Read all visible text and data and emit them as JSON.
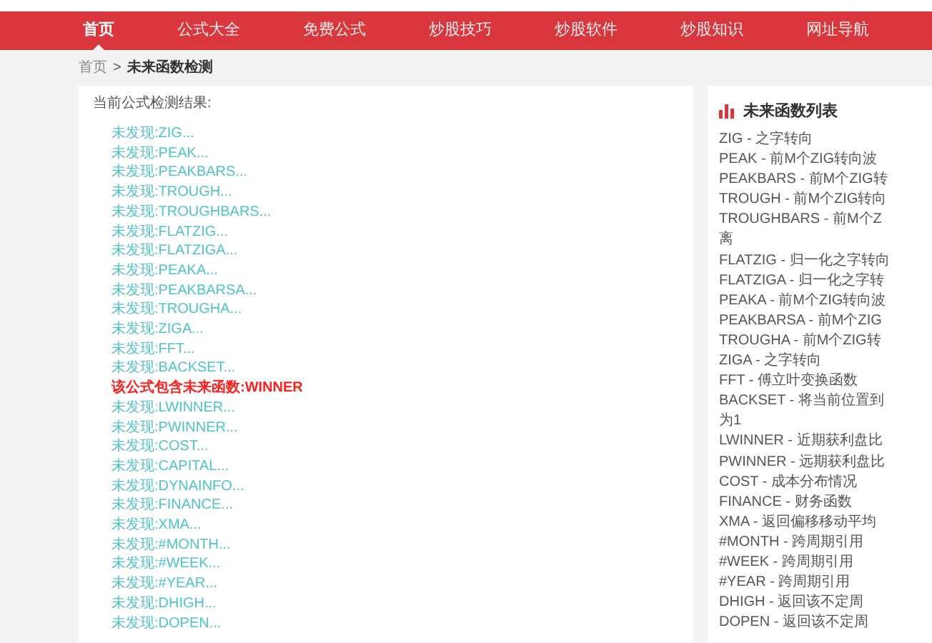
{
  "nav": [
    {
      "label": "首页",
      "selected": true
    },
    {
      "label": "公式大全",
      "selected": false
    },
    {
      "label": "免费公式",
      "selected": false
    },
    {
      "label": "炒股技巧",
      "selected": false
    },
    {
      "label": "炒股软件",
      "selected": false
    },
    {
      "label": "炒股知识",
      "selected": false
    },
    {
      "label": "网址导航",
      "selected": false
    }
  ],
  "breadcrumb": {
    "home": "首页",
    "separator": ">",
    "current": "未来函数检测"
  },
  "results": {
    "title": "当前公式检测结果:",
    "items": [
      {
        "kind": "ok",
        "text": "未发现:ZIG..."
      },
      {
        "kind": "ok",
        "text": "未发现:PEAK..."
      },
      {
        "kind": "ok",
        "text": "未发现:PEAKBARS..."
      },
      {
        "kind": "ok",
        "text": "未发现:TROUGH..."
      },
      {
        "kind": "ok",
        "text": "未发现:TROUGHBARS..."
      },
      {
        "kind": "ok",
        "text": "未发现:FLATZIG..."
      },
      {
        "kind": "ok",
        "text": "未发现:FLATZIGA..."
      },
      {
        "kind": "ok",
        "text": "未发现:PEAKA..."
      },
      {
        "kind": "ok",
        "text": "未发现:PEAKBARSA..."
      },
      {
        "kind": "ok",
        "text": "未发现:TROUGHA..."
      },
      {
        "kind": "ok",
        "text": "未发现:ZIGA..."
      },
      {
        "kind": "ok",
        "text": "未发现:FFT..."
      },
      {
        "kind": "ok",
        "text": "未发现:BACKSET..."
      },
      {
        "kind": "found",
        "text": "该公式包含未来函数:WINNER"
      },
      {
        "kind": "ok",
        "text": "未发现:LWINNER..."
      },
      {
        "kind": "ok",
        "text": "未发现:PWINNER..."
      },
      {
        "kind": "ok",
        "text": "未发现:COST..."
      },
      {
        "kind": "ok",
        "text": "未发现:CAPITAL..."
      },
      {
        "kind": "ok",
        "text": "未发现:DYNAINFO..."
      },
      {
        "kind": "ok",
        "text": "未发现:FINANCE..."
      },
      {
        "kind": "ok",
        "text": "未发现:XMA..."
      },
      {
        "kind": "ok",
        "text": "未发现:#MONTH..."
      },
      {
        "kind": "ok",
        "text": "未发现:#WEEK..."
      },
      {
        "kind": "ok",
        "text": "未发现:#YEAR..."
      },
      {
        "kind": "ok",
        "text": "未发现:DHIGH..."
      },
      {
        "kind": "ok",
        "text": "未发现:DOPEN..."
      }
    ]
  },
  "sidebar": {
    "title": "未来函数列表",
    "items": [
      "ZIG - 之字转向",
      "PEAK - 前M个ZIG转向波",
      "PEAKBARS - 前M个ZIG转",
      "TROUGH - 前M个ZIG转向",
      "TROUGHBARS - 前M个Z",
      "离",
      "FLATZIG - 归一化之字转向",
      "FLATZIGA - 归一化之字转",
      "PEAKA - 前M个ZIG转向波",
      "PEAKBARSA - 前M个ZIG",
      "TROUGHA - 前M个ZIG转",
      "ZIGA - 之字转向",
      "FFT - 傅立叶变换函数",
      "BACKSET - 将当前位置到",
      "为1",
      "LWINNER - 近期获利盘比",
      "PWINNER - 远期获利盘比",
      "COST - 成本分布情况",
      "FINANCE - 财务函数",
      "XMA - 返回偏移移动平均",
      "#MONTH - 跨周期引用",
      "#WEEK - 跨周期引用",
      "#YEAR - 跨周期引用",
      "DHIGH - 返回该不定周",
      "DOPEN - 返回该不定周"
    ]
  }
}
